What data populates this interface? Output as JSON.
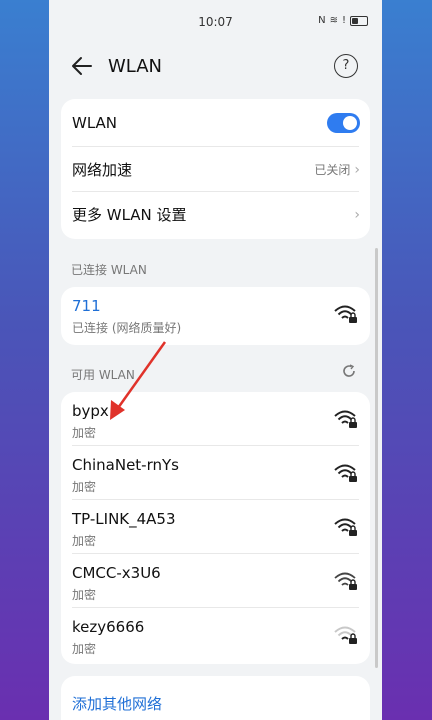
{
  "status": {
    "time": "10:07"
  },
  "header": {
    "title": "WLAN",
    "help": "?"
  },
  "settings": {
    "wlan_label": "WLAN",
    "wlan_on": true,
    "accel_label": "网络加速",
    "accel_value": "已关闭",
    "more_label": "更多 WLAN 设置"
  },
  "connected": {
    "section": "已连接 WLAN",
    "name": "711",
    "status": "已连接 (网络质量好)"
  },
  "available": {
    "section": "可用 WLAN",
    "networks": [
      {
        "name": "bypx",
        "security": "加密"
      },
      {
        "name": "ChinaNet-rnYs",
        "security": "加密"
      },
      {
        "name": "TP-LINK_4A53",
        "security": "加密"
      },
      {
        "name": "CMCC-x3U6",
        "security": "加密"
      },
      {
        "name": "kezy6666",
        "security": "加密"
      }
    ]
  },
  "add_network": "添加其他网络",
  "colors": {
    "accent": "#2f7cf0",
    "link": "#1f6fd6",
    "arrow": "#e0322a"
  }
}
